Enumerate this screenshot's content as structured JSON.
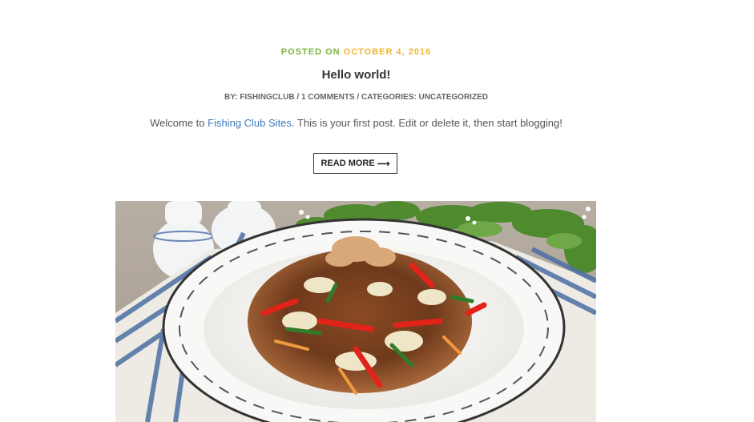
{
  "post": {
    "posted_label": "POSTED ON",
    "posted_date": "OCTOBER 4, 2016",
    "title": "Hello world!",
    "meta": {
      "by_prefix": "BY:",
      "author": "FISHINGCLUB",
      "comments": "1 COMMENTS",
      "categories_prefix": "CATEGORIES:",
      "category": "UNCATEGORIZED",
      "separator": "/"
    },
    "excerpt": {
      "before_link": "Welcome to ",
      "link_text": "Fishing Club Sites",
      "after_link": ". This is your first post. Edit or delete it, then start blogging!"
    },
    "read_more_label": "READ MORE",
    "read_more_arrow": "⟶"
  },
  "colors": {
    "posted_label": "#7cb342",
    "posted_date": "#f2b632",
    "link": "#3b7bbf"
  }
}
